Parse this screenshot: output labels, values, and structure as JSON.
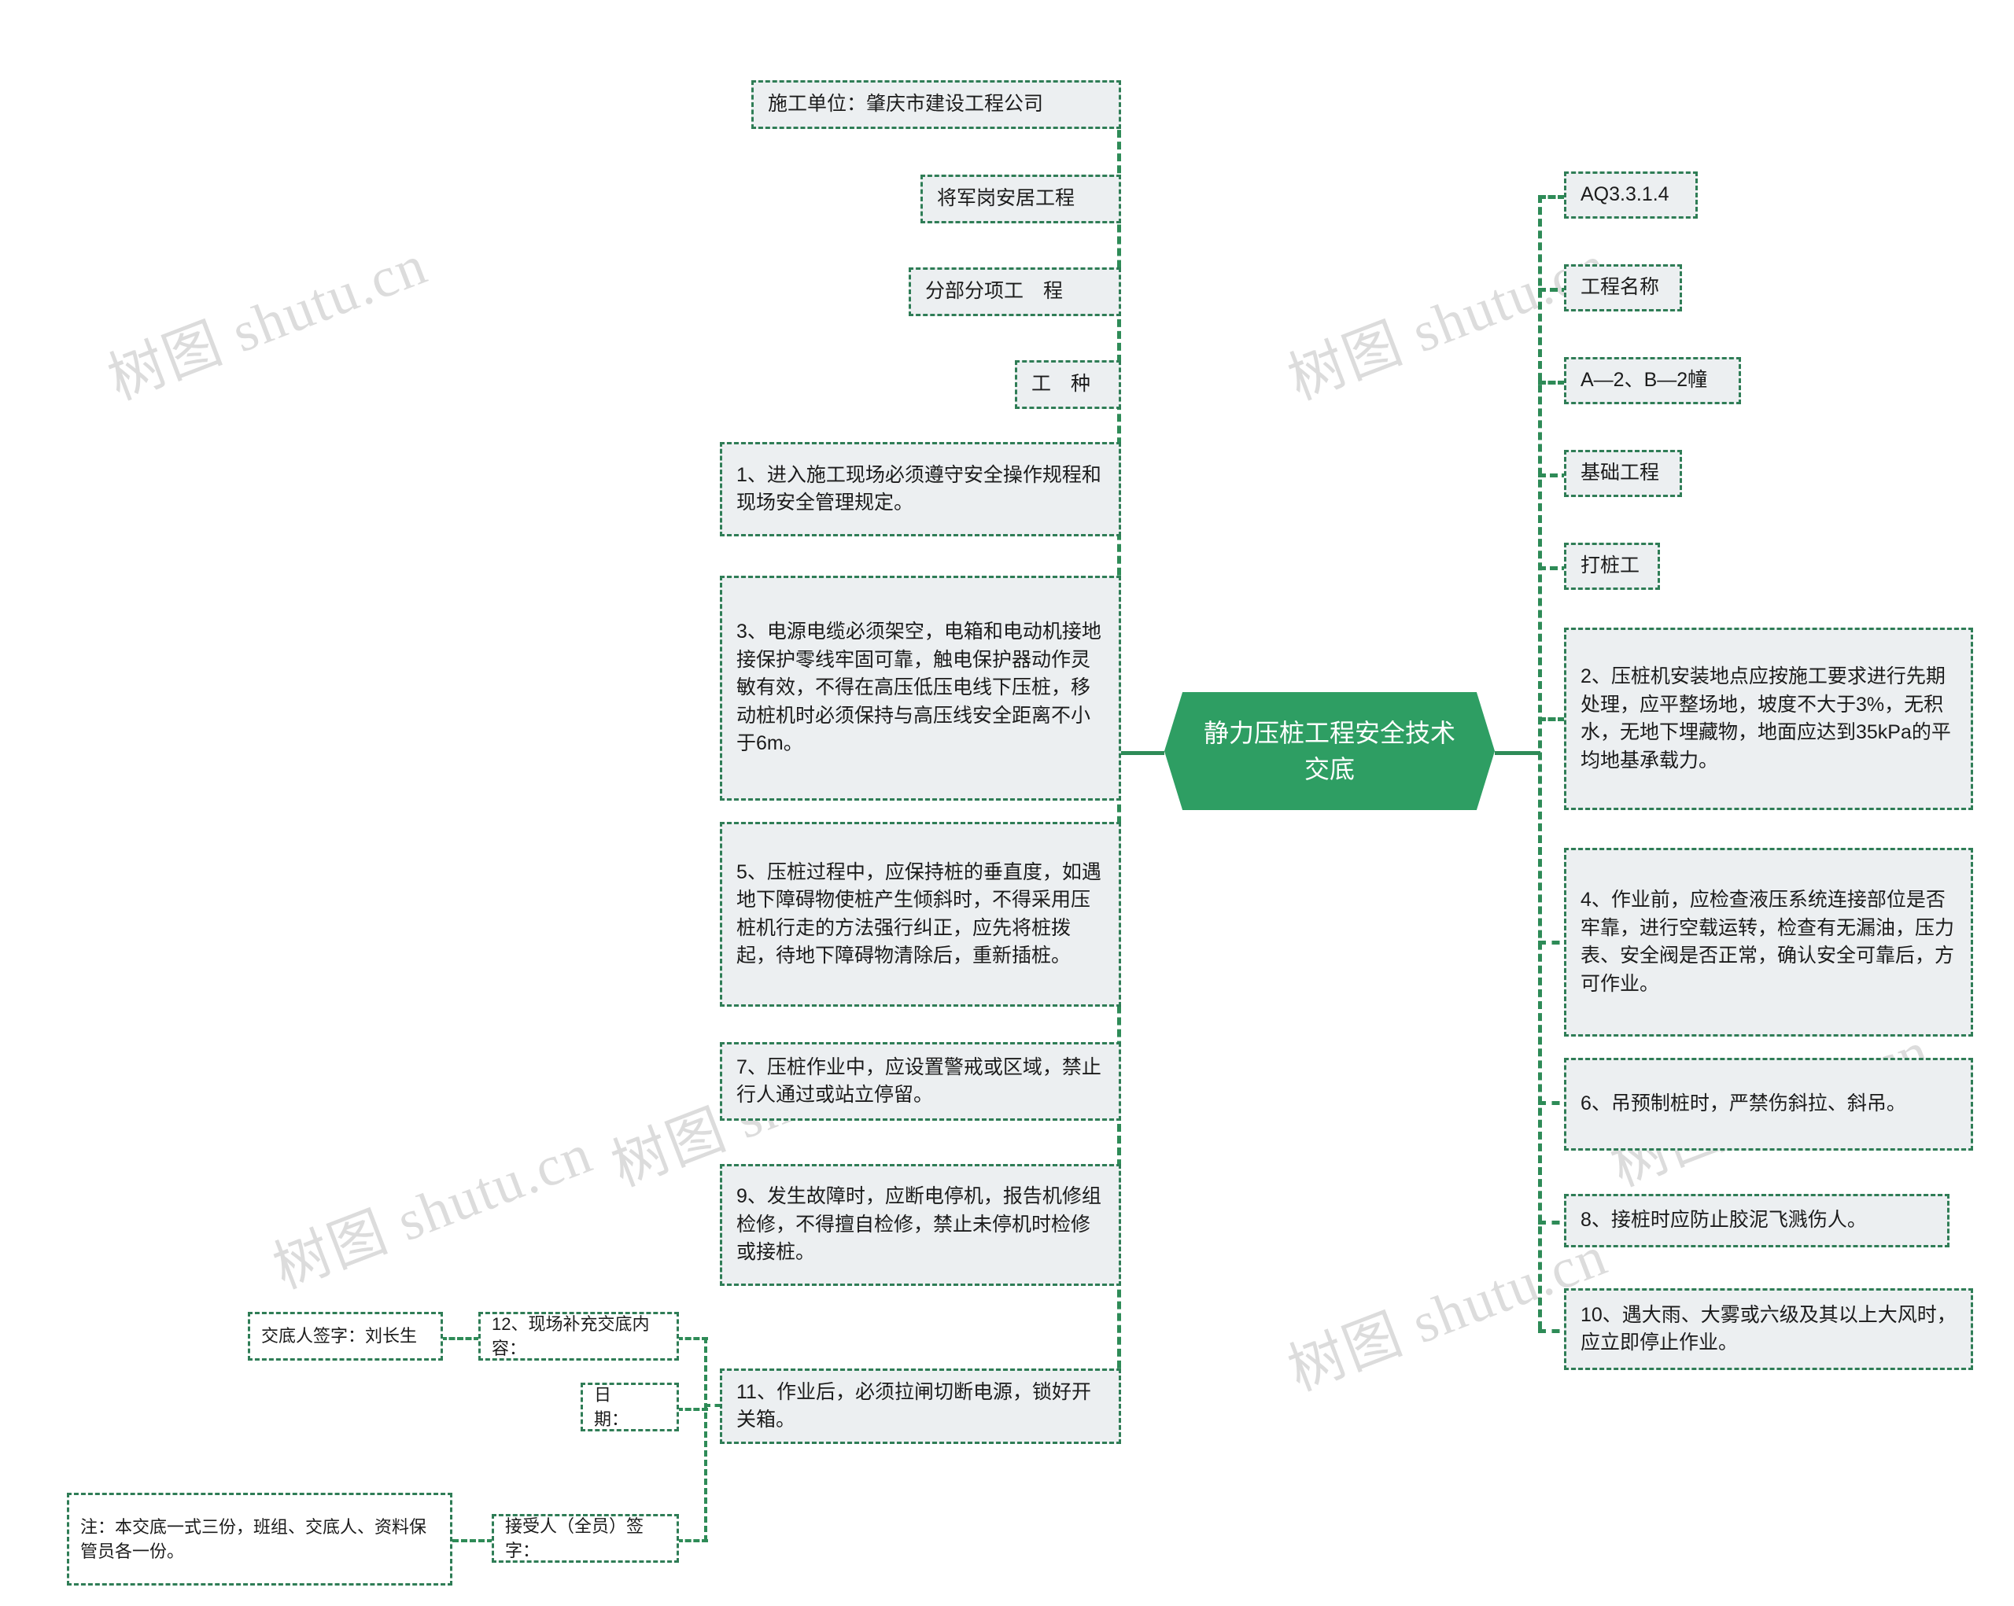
{
  "diagram": {
    "type": "mindmap",
    "root": {
      "label": "静力压桩工程安全技术交底",
      "color": "#2e9e63",
      "text_color": "#ffffff"
    },
    "node_fill": "#eceff1",
    "node_border": "#2f7d56",
    "watermark_text": "树图 shutu.cn",
    "left_branch": [
      {
        "id": "l1",
        "label": "施工单位：肇庆市建设工程公司"
      },
      {
        "id": "l2",
        "label": "将军岗安居工程"
      },
      {
        "id": "l3",
        "label": "分部分项工　程"
      },
      {
        "id": "l4",
        "label": "工　种"
      },
      {
        "id": "l5",
        "label": "1、进入施工现场必须遵守安全操作规程和现场安全管理规定。"
      },
      {
        "id": "l6",
        "label": "3、电源电缆必须架空，电箱和电动机接地接保护零线牢固可靠，触电保护器动作灵敏有效，不得在高压低压电线下压桩，移动桩机时必须保持与高压线安全距离不小于6m。"
      },
      {
        "id": "l7",
        "label": "5、压桩过程中，应保持桩的垂直度，如遇地下障碍物使桩产生倾斜时，不得采用压桩机行走的方法强行纠正，应先将桩拨起，待地下障碍物清除后，重新插桩。"
      },
      {
        "id": "l8",
        "label": "7、压桩作业中，应设置警戒或区域，禁止行人通过或站立停留。"
      },
      {
        "id": "l9",
        "label": "9、发生故障时，应断电停机，报告机修组检修，不得擅自检修，禁止未停机时检修或接桩。"
      },
      {
        "id": "l10",
        "label": "11、作业后，必须拉闸切断电源，锁好开关箱。"
      }
    ],
    "left_sub_of_11": [
      {
        "id": "s1",
        "label": "12、现场补充交底内容："
      },
      {
        "id": "s2",
        "label": "日　　期："
      },
      {
        "id": "s3",
        "label": "接受人（全员）签字："
      }
    ],
    "left_sub_of_12": [
      {
        "id": "s4",
        "label": "交底人签字：刘长生"
      }
    ],
    "left_sub_of_accept": [
      {
        "id": "s5",
        "label": "注：本交底一式三份，班组、交底人、资料保管员各一份。"
      }
    ],
    "right_branch": [
      {
        "id": "r1",
        "label": "AQ3.3.1.4"
      },
      {
        "id": "r2",
        "label": "工程名称"
      },
      {
        "id": "r3",
        "label": "A—2、B—2幢"
      },
      {
        "id": "r4",
        "label": "基础工程"
      },
      {
        "id": "r5",
        "label": "打桩工"
      },
      {
        "id": "r6",
        "label": "2、压桩机安装地点应按施工要求进行先期处理，应平整场地，坡度不大于3%，无积水，无地下埋藏物，地面应达到35kPa的平均地基承载力。"
      },
      {
        "id": "r7",
        "label": "4、作业前，应检查液压系统连接部位是否牢靠，进行空载运转，检查有无漏油，压力表、安全阀是否正常，确认安全可靠后，方可作业。"
      },
      {
        "id": "r8",
        "label": "6、吊预制桩时，严禁伤斜拉、斜吊。"
      },
      {
        "id": "r9",
        "label": "8、接桩时应防止胶泥飞溅伤人。"
      },
      {
        "id": "r10",
        "label": "10、遇大雨、大雾或六级及其以上大风时，应立即停止作业。"
      }
    ]
  }
}
